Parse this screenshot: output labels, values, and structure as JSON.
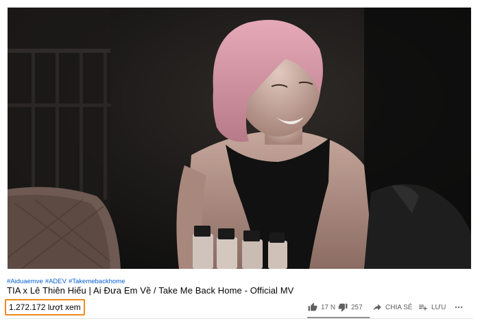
{
  "video": {
    "hashtags": [
      "#Aiduaemve",
      "#ADEV",
      "#Takemebackhome"
    ],
    "title": "TIA x Lê Thiên Hiếu | Ai Đưa Em Về / Take Me Back Home - Official MV",
    "views": "1.272.172 lượt xem"
  },
  "actions": {
    "like_count": "17 N",
    "dislike_count": "257",
    "share_label": "CHIA SẺ",
    "save_label": "LƯU"
  },
  "sentiment": {
    "like_fraction": 0.985
  },
  "icons": {
    "like": "thumbs-up-icon",
    "dislike": "thumbs-down-icon",
    "share": "share-arrow-icon",
    "save": "playlist-add-icon",
    "more": "more-horizontal-icon"
  }
}
